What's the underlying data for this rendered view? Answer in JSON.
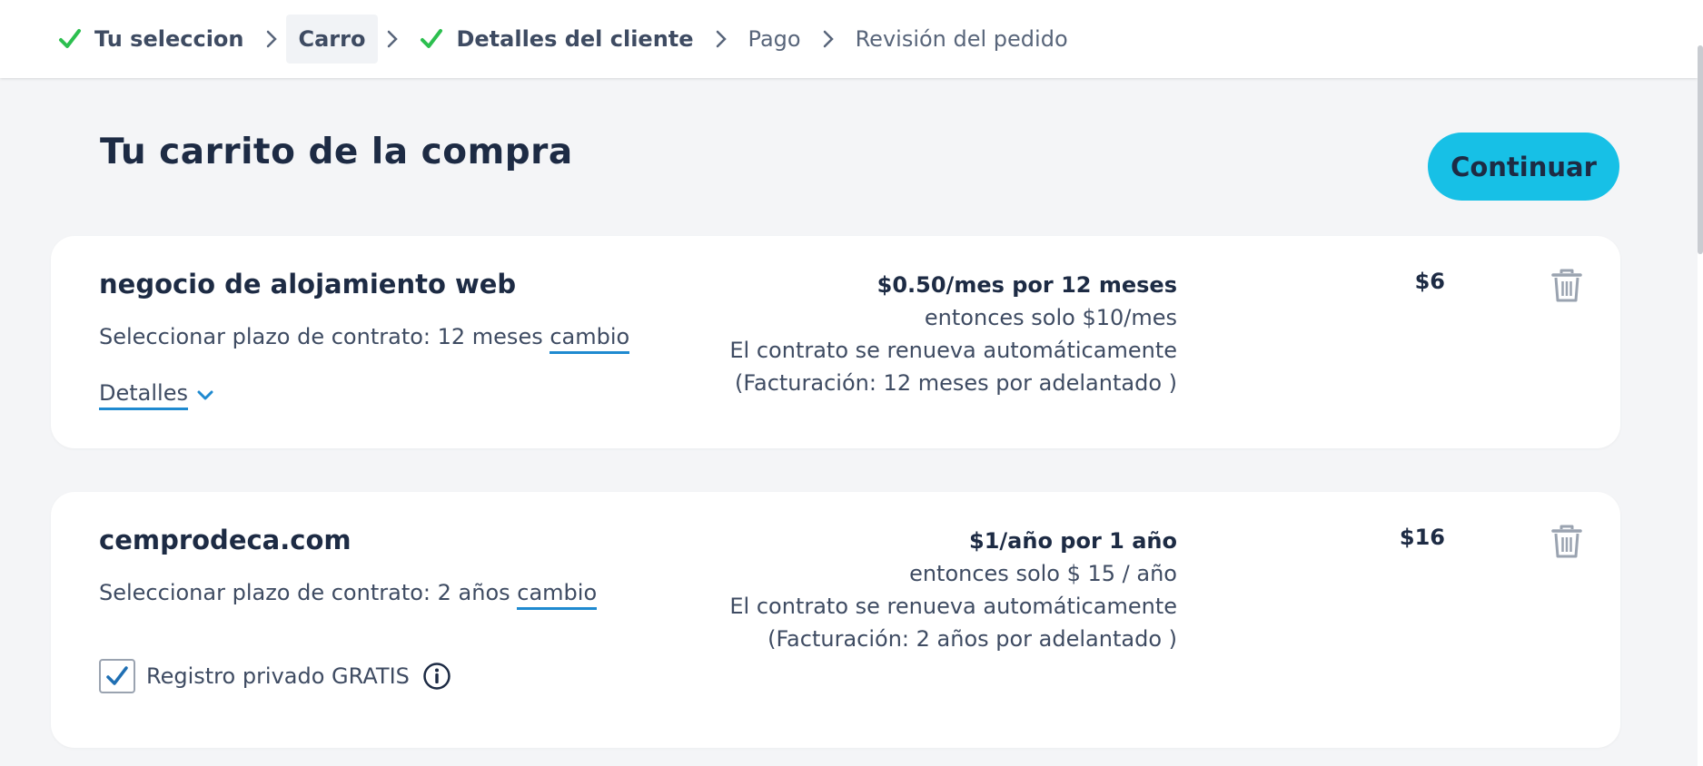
{
  "breadcrumb": {
    "steps": [
      {
        "label": "Tu seleccion",
        "state": "done"
      },
      {
        "label": "Carro",
        "state": "active"
      },
      {
        "label": "Detalles del cliente",
        "state": "done"
      },
      {
        "label": "Pago",
        "state": "todo"
      },
      {
        "label": "Revisión del pedido",
        "state": "todo"
      }
    ]
  },
  "header": {
    "title": "Tu carrito de la compra",
    "continue_label": "Continuar"
  },
  "items": [
    {
      "name": "negocio de alojamiento web",
      "term_prefix": "Seleccionar plazo de contrato: 12 meses",
      "change_label": "cambio",
      "details_label": "Detalles",
      "price_headline": "$0.50/mes por 12 meses",
      "price_then": "entonces solo $10/mes",
      "renewal": "El contrato se renueva automáticamente",
      "billing": "(Facturación: 12 meses por adelantado )",
      "total": "$6"
    },
    {
      "name": "cemprodeca.com",
      "term_prefix": "Seleccionar plazo de contrato: 2 años",
      "change_label": "cambio",
      "privacy_label": "Registro privado GRATIS",
      "privacy_checked": true,
      "price_headline": "$1/año por 1 año",
      "price_then": "entonces solo $ 15 / año",
      "renewal": "El contrato se renueva automáticamente",
      "billing": "(Facturación: 2 años por adelantado )",
      "total": "$16"
    }
  ],
  "colors": {
    "accent": "#17c0e6",
    "check": "#2cbf4f",
    "link_underline": "#1f8ad0",
    "text_dark": "#1d2b44",
    "background": "#f4f5f7"
  },
  "icons": {
    "check": "check-icon",
    "separator": "chevron-right-icon",
    "trash": "trash-icon",
    "details": "chevron-down-icon",
    "info": "info-icon"
  }
}
